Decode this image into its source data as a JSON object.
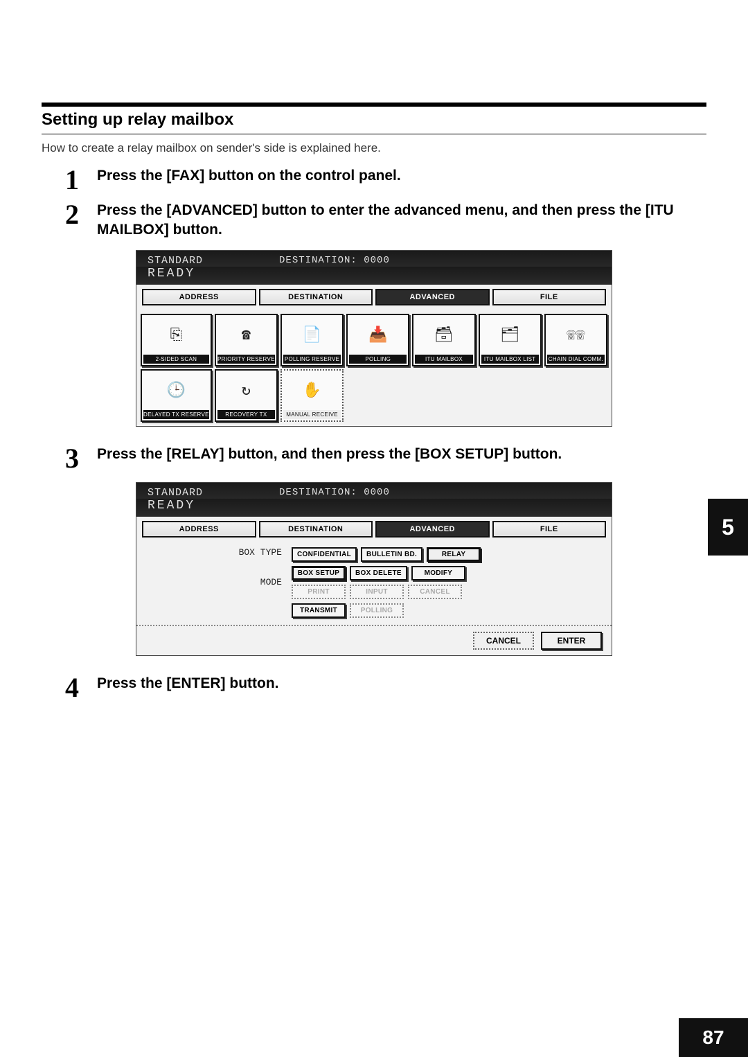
{
  "chapter_tab": "5",
  "page_number": "87",
  "section": {
    "title": "Setting up relay mailbox",
    "intro": "How to create a relay mailbox on sender's side is explained here."
  },
  "steps": [
    {
      "num": "1",
      "title": "Press the [FAX] button on the control panel."
    },
    {
      "num": "2",
      "title": "Press the [ADVANCED] button to enter the advanced menu, and then press the [ITU MAILBOX] button."
    },
    {
      "num": "3",
      "title": "Press the [RELAY] button, and then press the [BOX SETUP] button."
    },
    {
      "num": "4",
      "title": "Press the [ENTER] button."
    }
  ],
  "screen1": {
    "mode": "STANDARD",
    "destination_label": "DESTINATION: 0000",
    "status": "READY",
    "tabs": {
      "address": "ADDRESS",
      "destination": "DESTINATION",
      "advanced": "ADVANCED",
      "file": "FILE"
    },
    "buttons": {
      "two_sided_scan": "2-SIDED SCAN",
      "priority_reserve": "PRIORITY RESERVE",
      "polling_reserve": "POLLING RESERVE",
      "polling": "POLLING",
      "itu_mailbox": "ITU MAILBOX",
      "itu_mailbox_list": "ITU MAILBOX LIST",
      "chain_dial_comm": "CHAIN DIAL COMM.",
      "delayed_tx_reserve": "DELAYED TX RESERVE",
      "recovery_tx": "RECOVERY TX",
      "manual_receive": "MANUAL RECEIVE"
    }
  },
  "screen2": {
    "mode": "STANDARD",
    "destination_label": "DESTINATION: 0000",
    "status": "READY",
    "tabs": {
      "address": "ADDRESS",
      "destination": "DESTINATION",
      "advanced": "ADVANCED",
      "file": "FILE"
    },
    "labels": {
      "box_type": "BOX TYPE",
      "mode": "MODE"
    },
    "box_type": {
      "confidential": "CONFIDENTIAL",
      "bulletin": "BULLETIN BD.",
      "relay": "RELAY"
    },
    "mode_row1": {
      "box_setup": "BOX SETUP",
      "box_delete": "BOX DELETE",
      "modify": "MODIFY"
    },
    "mode_row2": {
      "print": "PRINT",
      "input": "INPUT",
      "cancel": "CANCEL"
    },
    "mode_row3": {
      "transmit": "TRANSMIT",
      "polling": "POLLING"
    },
    "bottom": {
      "cancel": "CANCEL",
      "enter": "ENTER"
    }
  }
}
